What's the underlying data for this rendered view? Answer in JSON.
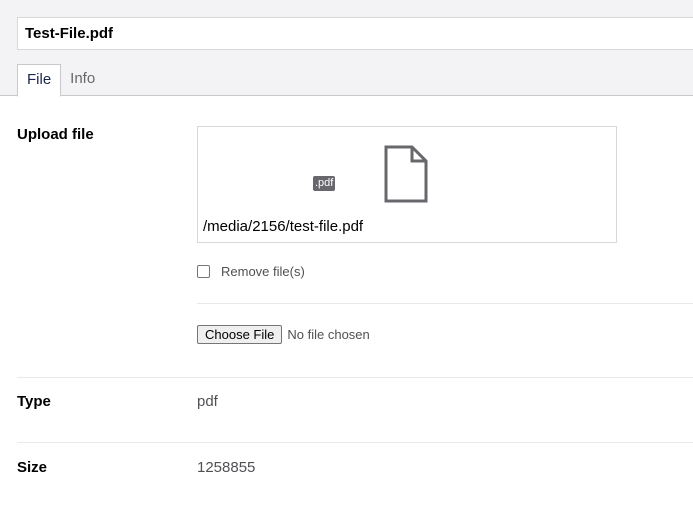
{
  "header": {
    "file_name": "Test-File.pdf",
    "tabs": [
      {
        "label": "File",
        "active": true
      },
      {
        "label": "Info",
        "active": false
      }
    ]
  },
  "upload": {
    "label": "Upload file",
    "extension_badge": ".pdf",
    "file_icon": "document-icon",
    "file_path": "/media/2156/test-file.pdf",
    "remove_label": "Remove file(s)",
    "remove_checked": false,
    "choose_button_label": "Choose File",
    "no_file_text": "No file chosen"
  },
  "type": {
    "label": "Type",
    "value": "pdf"
  },
  "size": {
    "label": "Size",
    "value": "1258855"
  }
}
